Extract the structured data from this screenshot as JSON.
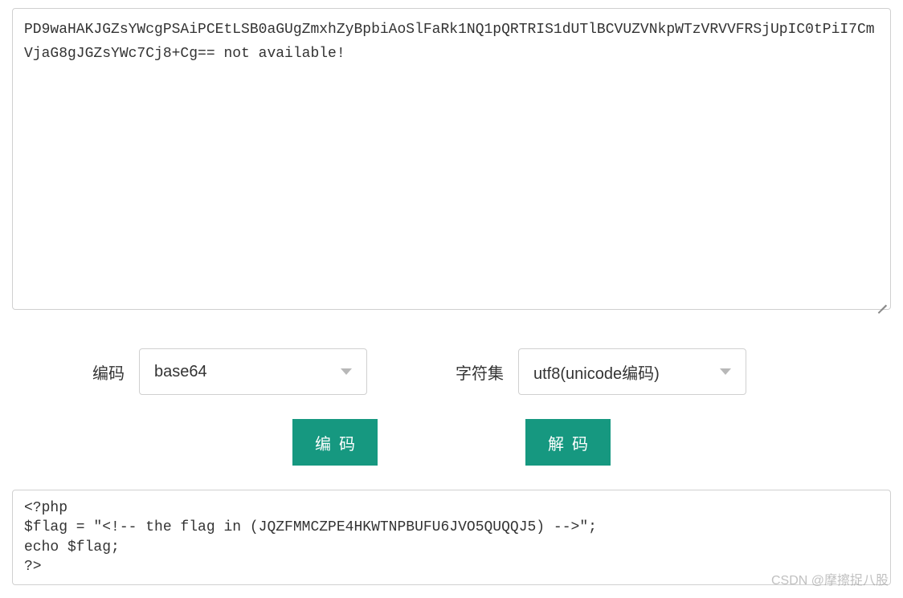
{
  "input": {
    "value": "PD9waHAKJGZsYWcgPSAiPCEtLSB0aGUgZmxhZyBpbiAoSlFaRk1NQ1pQRTRIS1dUTlBCVUZVNkpWTzVRVVFRSjUpIC0tPiI7CmVjaG8gJGZsYWc7Cj8+Cg== not available!"
  },
  "controls": {
    "encoding": {
      "label": "编码",
      "value": "base64"
    },
    "charset": {
      "label": "字符集",
      "value": "utf8(unicode编码)"
    }
  },
  "buttons": {
    "encode": "编码",
    "decode": "解码"
  },
  "output": {
    "value": "<?php\n$flag = \"<!-- the flag in (JQZFMMCZPE4HKWTNPBUFU6JVO5QUQQJ5) -->\";\necho $flag;\n?>"
  },
  "watermark": "CSDN @摩擦捉八股"
}
